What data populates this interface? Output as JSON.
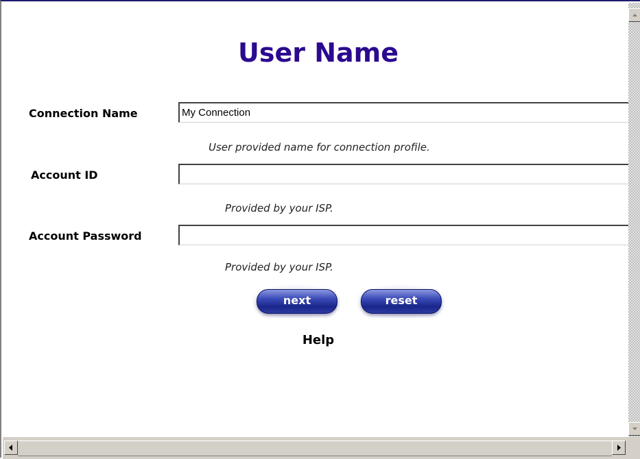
{
  "page": {
    "title": "User Name"
  },
  "form": {
    "connection_name": {
      "label": "Connection Name",
      "value": "My Connection",
      "hint": "User provided name for connection profile."
    },
    "account_id": {
      "label": "Account ID",
      "value": "",
      "hint": "Provided by your ISP."
    },
    "account_password": {
      "label": "Account Password",
      "value": "",
      "hint": "Provided by your ISP."
    }
  },
  "buttons": {
    "next_label": "next",
    "reset_label": "reset"
  },
  "help_label": "Help",
  "scrollbar_icons": {
    "up": "arrow-up-icon",
    "down": "arrow-down-icon",
    "left": "arrow-left-icon",
    "right": "arrow-right-icon"
  },
  "colors": {
    "title": "#2b0a8f",
    "button": "#1a268a"
  }
}
